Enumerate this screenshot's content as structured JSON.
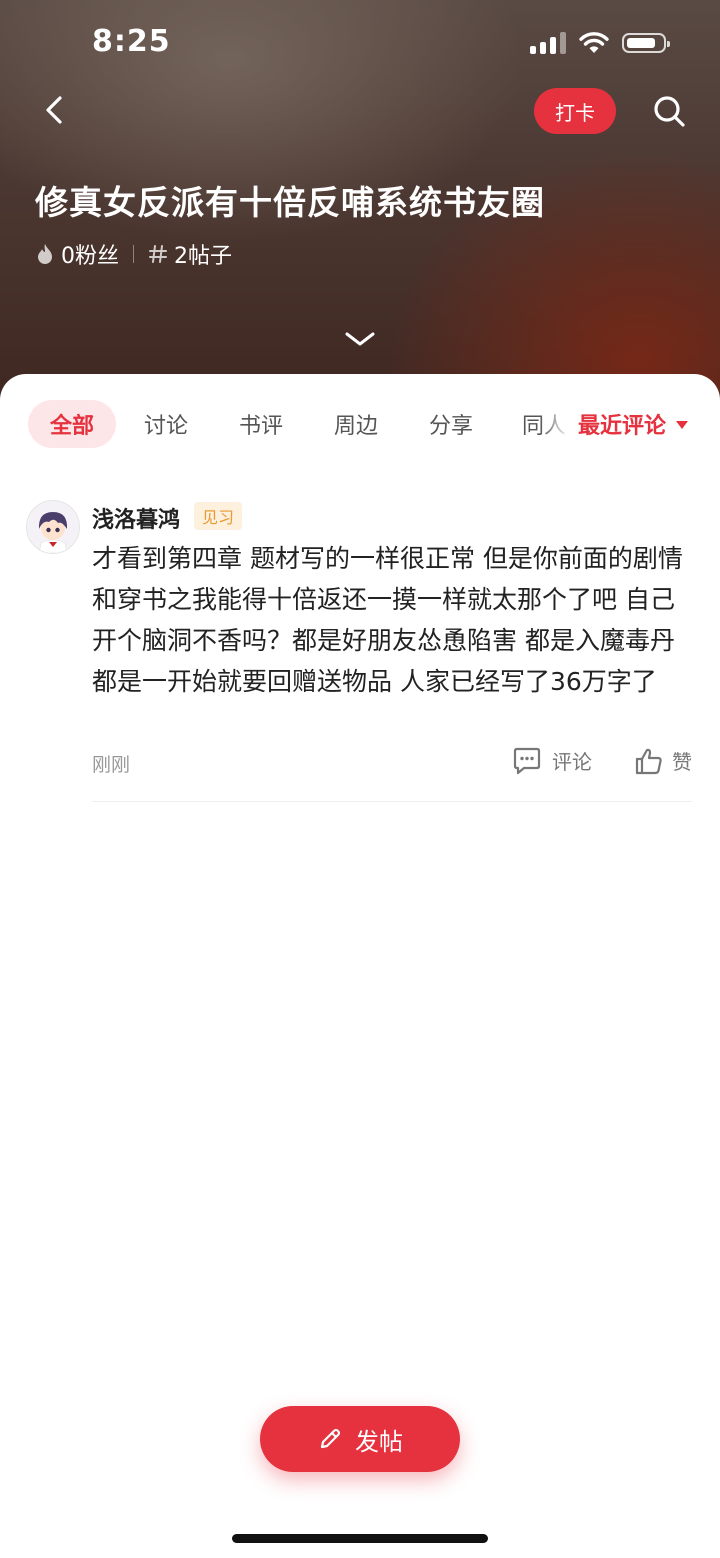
{
  "status_bar": {
    "time": "8:25"
  },
  "header": {
    "checkin_label": "打卡",
    "title": "修真女反派有十倍反哺系统书友圈",
    "fans": "0粉丝",
    "posts": "2帖子"
  },
  "tabs": {
    "items": [
      "全部",
      "讨论",
      "书评",
      "周边",
      "分享",
      "同人"
    ],
    "sort_label": "最近评论"
  },
  "post": {
    "username": "浅洛暮鸿",
    "level": "见习",
    "content": "才看到第四章 题材写的一样很正常 但是你前面的剧情和穿书之我能得十倍返还一摸一样就太那个了吧 自己开个脑洞不香吗？都是好朋友怂恿陷害 都是入魔毒丹 都是一开始就要回赠送物品 人家已经写了36万字了",
    "time": "刚刚",
    "comment_label": "评论",
    "like_label": "赞"
  },
  "fab": {
    "label": "发帖"
  },
  "colors": {
    "accent": "#e5323e",
    "badge_text": "#e99a35",
    "badge_bg": "#fdf0dd"
  }
}
